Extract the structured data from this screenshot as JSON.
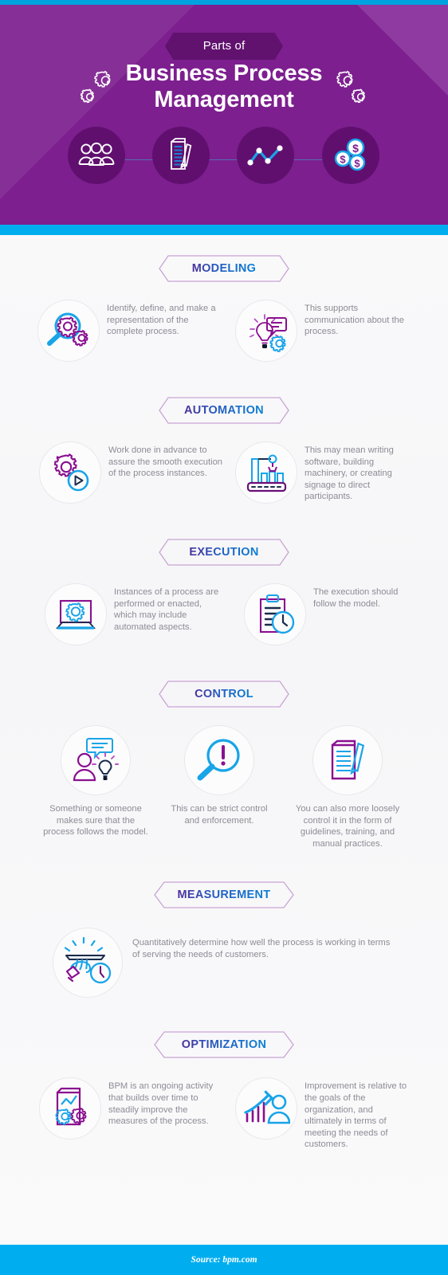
{
  "header": {
    "eyebrow": "Parts of",
    "title_line1": "Business Process",
    "title_line2": "Management",
    "background_color": "#7d1f8f",
    "accent_color": "#00aeef",
    "circle_color": "#600f6f",
    "icons": [
      {
        "name": "people-group-icon",
        "label": "People"
      },
      {
        "name": "document-pencil-icon",
        "label": "Document"
      },
      {
        "name": "line-chart-icon",
        "label": "Chart"
      },
      {
        "name": "money-coins-icon",
        "label": "Money"
      }
    ]
  },
  "sections": [
    {
      "id": "modeling",
      "label": "MODELING",
      "layout": "two-side",
      "items": [
        {
          "icon": "magnifier-gears-icon",
          "text": "Identify, define, and make a representation of the complete process."
        },
        {
          "icon": "lightbulb-speech-gear-icon",
          "text": "This supports communication about the process."
        }
      ]
    },
    {
      "id": "automation",
      "label": "AUTOMATION",
      "layout": "two-side",
      "items": [
        {
          "icon": "gear-play-icon",
          "text": "Work done in advance to assure the smooth execution of the process instances."
        },
        {
          "icon": "factory-robot-icon",
          "text": "This may mean writing software, building machinery, or creating signage to direct participants."
        }
      ]
    },
    {
      "id": "execution",
      "label": "EXECUTION",
      "layout": "two-side",
      "items": [
        {
          "icon": "laptop-gear-icon",
          "text": "Instances of a process are performed or enacted, which may include automated aspects."
        },
        {
          "icon": "clipboard-clock-icon",
          "text": "The execution should follow the model."
        }
      ]
    },
    {
      "id": "control",
      "label": "CONTROL",
      "layout": "three-stacked",
      "items": [
        {
          "icon": "person-idea-speech-icon",
          "text": "Something or someone makes sure that the process follows the model."
        },
        {
          "icon": "magnifier-alert-icon",
          "text": "This can be strict control and enforcement."
        },
        {
          "icon": "document-pencil-outline-icon",
          "text": "You can also more loosely control it in the form of guidelines, training, and manual practices."
        }
      ]
    },
    {
      "id": "measurement",
      "label": "MEASUREMENT",
      "layout": "one-side",
      "items": [
        {
          "icon": "hand-tray-clock-icon",
          "text": "Quantitatively determine how well the process is working in terms of serving the needs of customers."
        }
      ]
    },
    {
      "id": "optimization",
      "label": "OPTIMIZATION",
      "layout": "two-side",
      "items": [
        {
          "icon": "report-gears-chart-icon",
          "text": "BPM is an ongoing activity that builds over time to steadily improve the measures of the process."
        },
        {
          "icon": "growth-bars-person-icon",
          "text": "Improvement is relative to the goals of the organization, and ultimately in terms of meeting the needs of customers."
        }
      ]
    }
  ],
  "footer": {
    "source": "Source: bpm.com"
  },
  "colors": {
    "purple": "#7d1f8f",
    "deep_purple": "#60126e",
    "blue": "#00aeef",
    "text_gray": "#8c8c96",
    "badge_border": "#c9a4d4"
  }
}
